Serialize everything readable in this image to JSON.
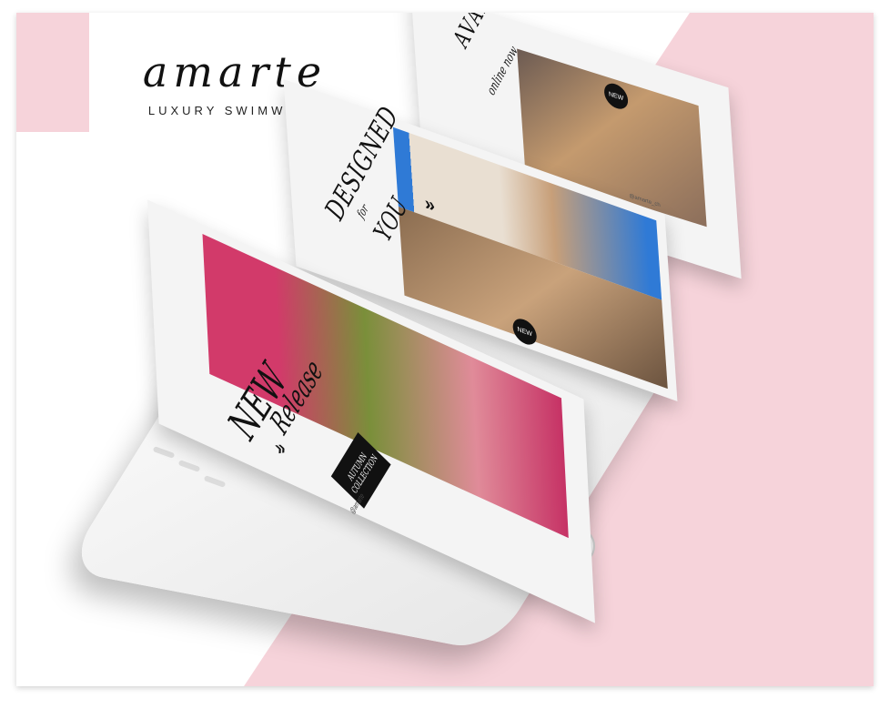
{
  "brand": {
    "name": "amarte",
    "tagline": "LUXURY SWIMWEAR"
  },
  "cards": {
    "top": {
      "title": "AVAILABLE",
      "subtitle": "online now",
      "badge": "NEW",
      "handle": "@amarte_ch"
    },
    "middle": {
      "title_1": "DESIGNED",
      "title_for": "for",
      "title_2": "YOU",
      "badge": "NEW",
      "chevron": "»"
    },
    "bottom": {
      "title_1": "NEW",
      "title_2": "Release",
      "collection_line_1": "AUTUMN",
      "collection_line_2": "COLLECTION",
      "handle": "@amarte",
      "chevron": "»"
    }
  },
  "icons": [
    "chevron-double-right-icon",
    "starburst-badge-icon",
    "home-button-icon"
  ],
  "colors": {
    "accent_pink": "#f6d3da",
    "photo_pink": "#d23a6a",
    "photo_blue": "#2f7ad6",
    "dark": "#111111"
  }
}
